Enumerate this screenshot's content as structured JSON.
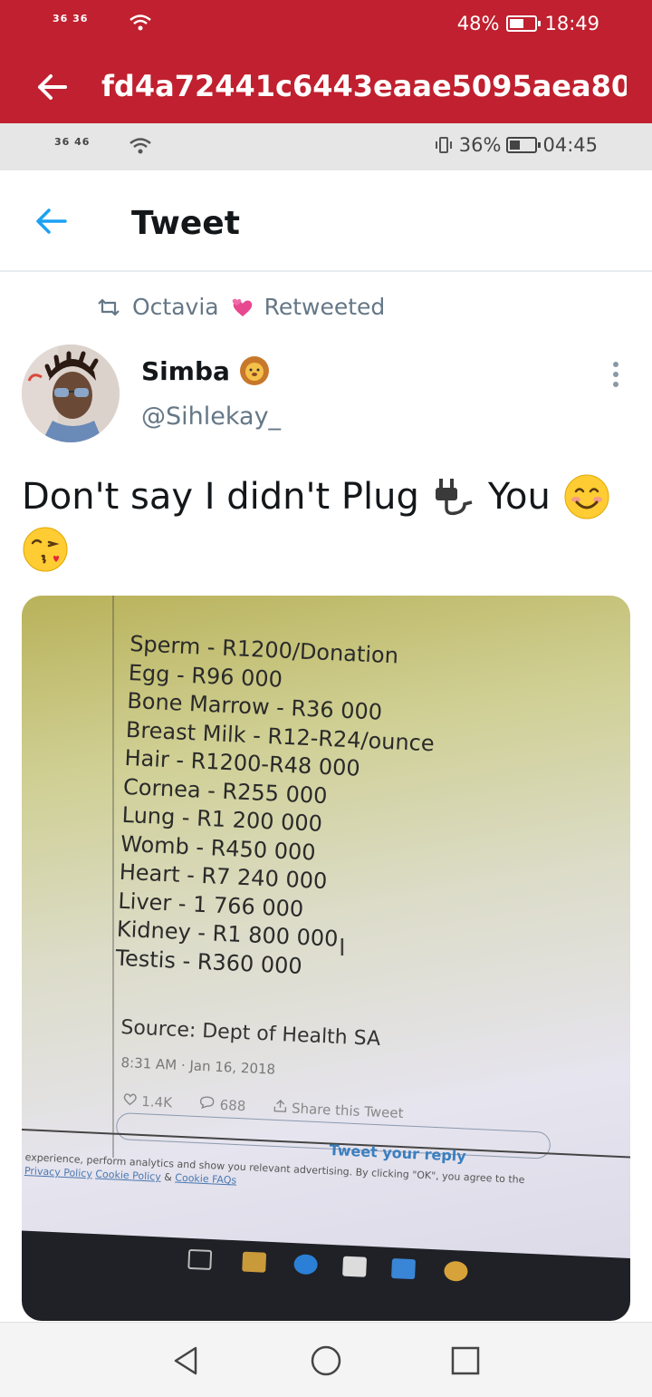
{
  "outer_status": {
    "signal": "36 36",
    "battery": "48%",
    "battery_level": 0.48,
    "time": "18:49"
  },
  "outer_appbar": {
    "title": "fd4a72441c6443eaae5095aea80..."
  },
  "inner_status": {
    "signal": "36 46",
    "battery": "36%",
    "battery_level": 0.36,
    "time": "04:45"
  },
  "header": {
    "title": "Tweet"
  },
  "retweet": {
    "user": "Octavia",
    "label": "Retweeted"
  },
  "author": {
    "name": "Simba",
    "handle": "@Sihlekay_"
  },
  "tweet": {
    "text_part1": "Don't say I didn't Plug",
    "text_part2": "You"
  },
  "photo": {
    "items": [
      "Sperm - R1200/Donation",
      "Egg - R96 000",
      "Bone Marrow - R36 000",
      "Breast Milk - R12-R24/ounce",
      "Hair - R1200-R48 000",
      "Cornea - R255 000",
      "Lung - R1 200 000",
      "Womb - R450 000",
      "Heart - R7 240 000",
      "Liver - 1 766 000",
      "Kidney - R1 800 000",
      "Testis - R360 000"
    ],
    "source": "Source: Dept of Health SA",
    "date": "8:31 AM · Jan 16, 2018",
    "likes": "1.4K",
    "replies": "688",
    "share": "Share this Tweet",
    "reply_button": "Tweet your reply",
    "cookie_line1": "experience, perform analytics and show you relevant advertising. By clicking \"OK\", you agree to the",
    "cookie_link1": "Privacy Policy",
    "cookie_link2": "Cookie Policy",
    "cookie_amp": "&",
    "cookie_link3": "Cookie FAQs"
  },
  "colors": {
    "app_red": "#c0202f",
    "twitter_blue": "#1da1f2",
    "muted": "#657786"
  }
}
